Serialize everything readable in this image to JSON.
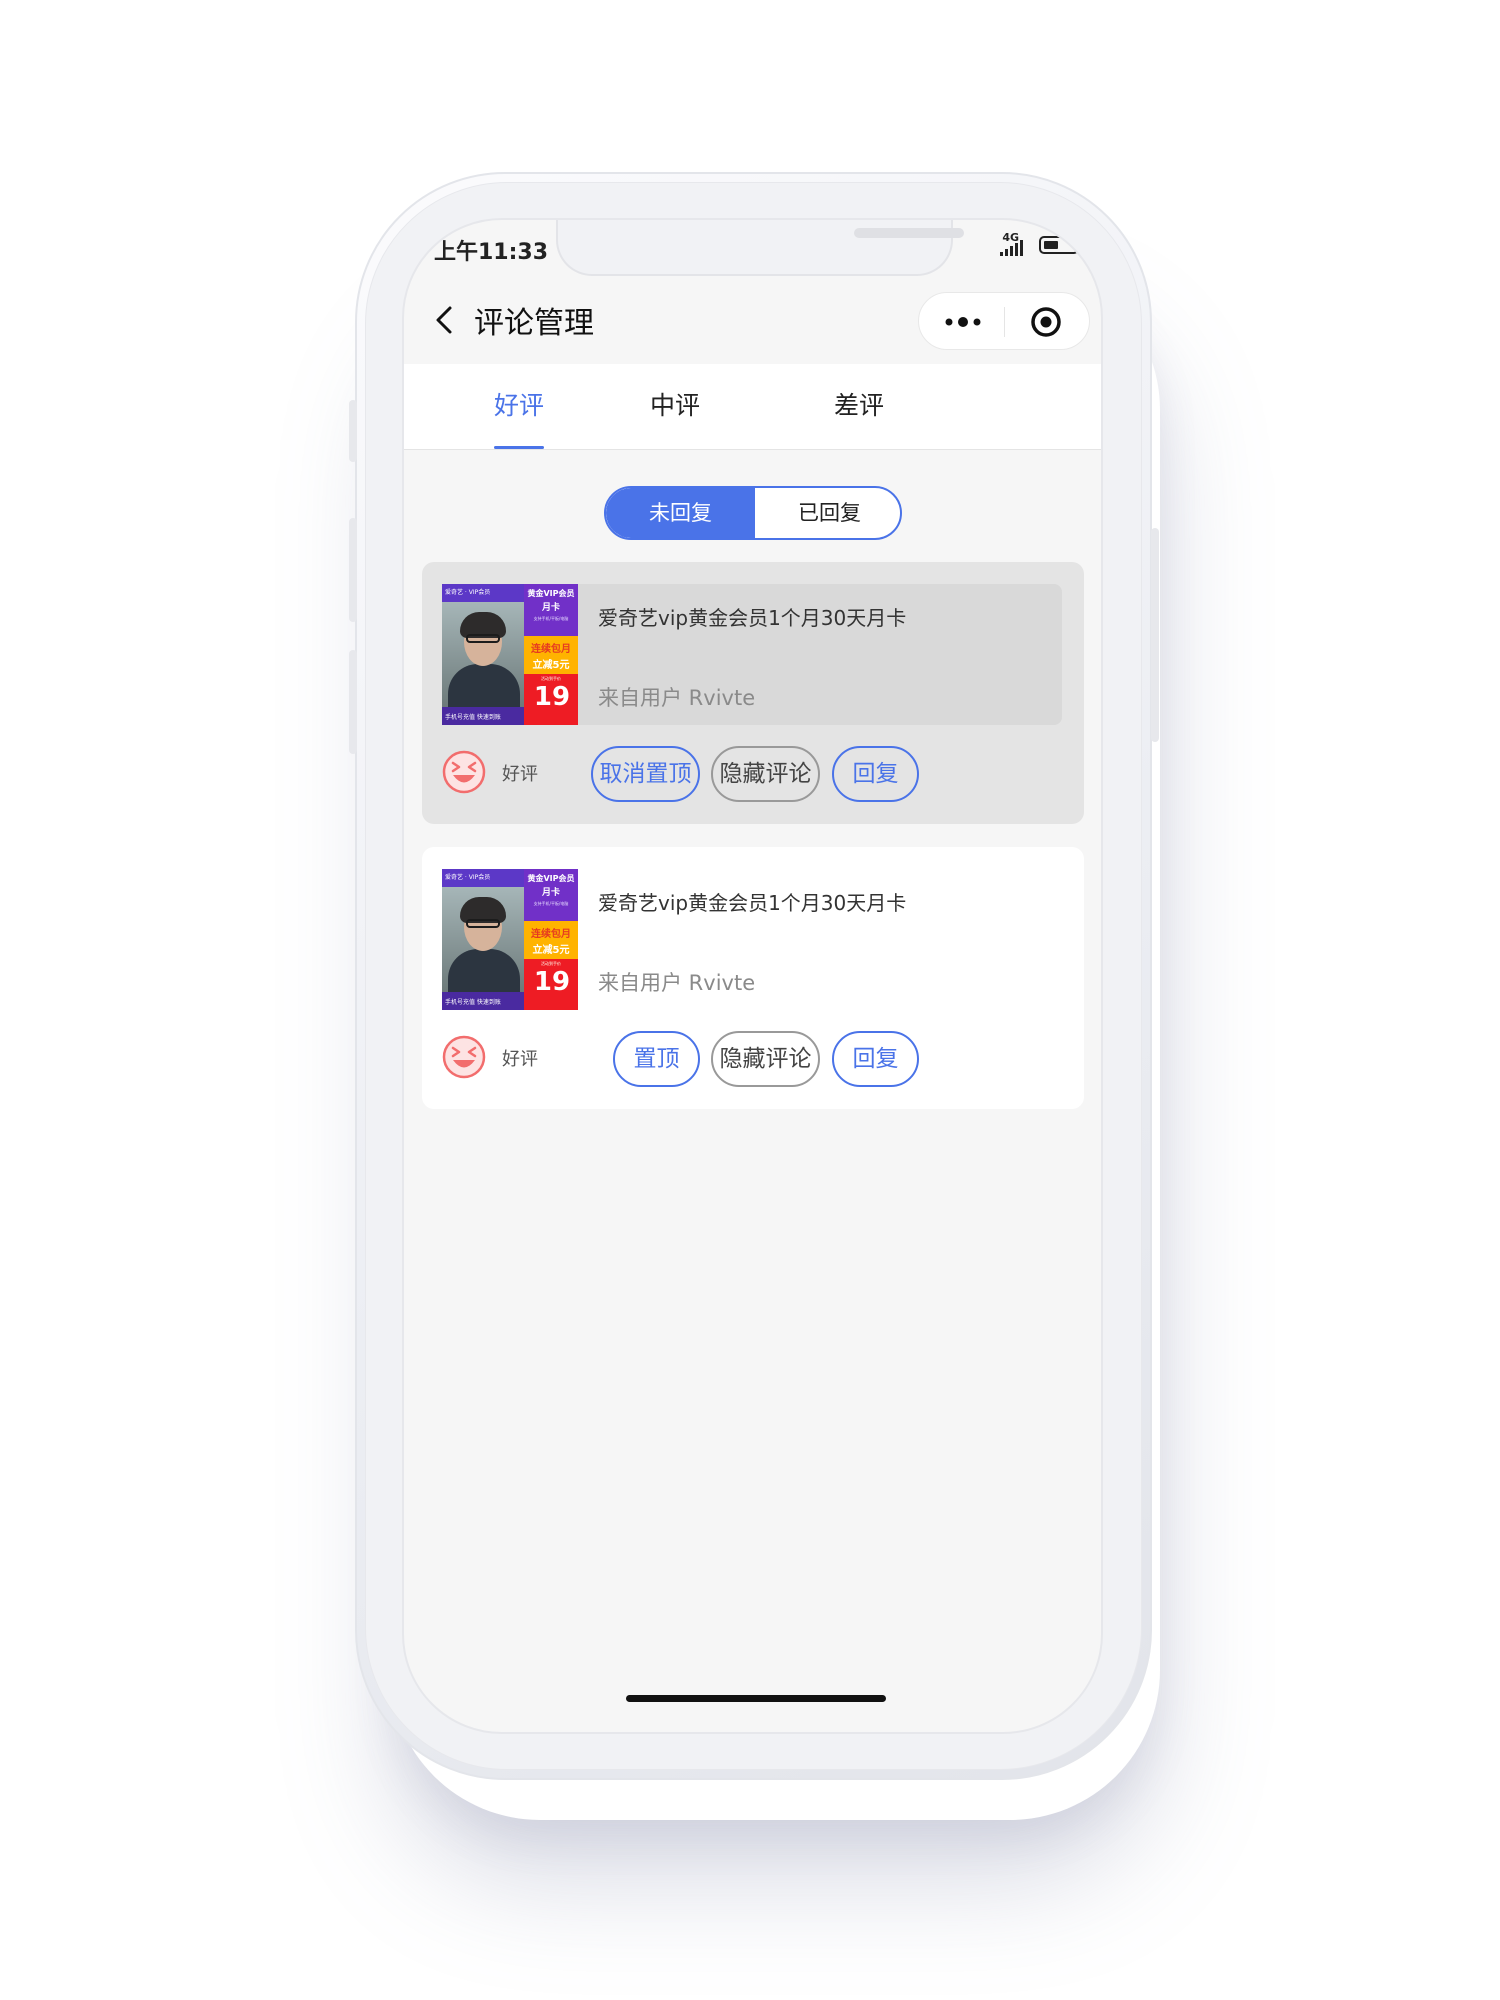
{
  "status_bar": {
    "time": "上午11:33",
    "network": "4G"
  },
  "navbar": {
    "title": "评论管理"
  },
  "tabs": [
    {
      "label": "好评",
      "active": true
    },
    {
      "label": "中评",
      "active": false
    },
    {
      "label": "差评",
      "active": false
    }
  ],
  "segment": {
    "unreplied": "未回复",
    "replied": "已回复",
    "selected": "未回复"
  },
  "comments": [
    {
      "product_title": "爱奇艺vip黄金会员1个月30天月卡",
      "user": "来自用户 Rvivte",
      "rating": "好评",
      "pin_button": "取消置顶",
      "hide_button": "隐藏评论",
      "reply_button": "回复",
      "pinned": true,
      "thumb": {
        "brand": "爱奇艺 · VIP会员",
        "promo_title": "黄金VIP会员",
        "promo_sub": "月卡",
        "promo_devices": "支持手机/平板/电脑",
        "deal_1": "连续包月",
        "deal_2": "立减5元",
        "price_note": "活动到手价",
        "price": "19",
        "bottom": "手机号充值  快速到账"
      }
    },
    {
      "product_title": "爱奇艺vip黄金会员1个月30天月卡",
      "user": "来自用户 Rvivte",
      "rating": "好评",
      "pin_button": "置顶",
      "hide_button": "隐藏评论",
      "reply_button": "回复",
      "pinned": false,
      "thumb": {
        "brand": "爱奇艺 · VIP会员",
        "promo_title": "黄金VIP会员",
        "promo_sub": "月卡",
        "promo_devices": "支持手机/平板/电脑",
        "deal_1": "连续包月",
        "deal_2": "立减5元",
        "price_note": "活动到手价",
        "price": "19",
        "bottom": "手机号充值  快速到账"
      }
    }
  ],
  "colors": {
    "accent": "#4a73e8",
    "pinned_card_bg": "#e4e4e4",
    "smiley": "#f26d6d"
  }
}
